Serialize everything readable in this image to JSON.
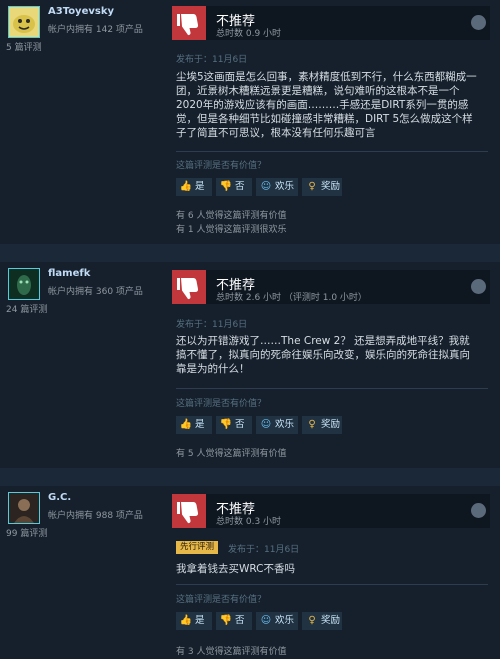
{
  "reviews": [
    {
      "username": "A3Toyevsky",
      "owned": "帐户内拥有 142 项产品",
      "review_count": "5 篇评测",
      "rec_title": "不推荐",
      "playtime": "总时数 0.9 小时",
      "posted": "发布于：11月6日",
      "content": "尘埃5这画面是怎么回事，素材精度低到不行，什么东西都糊成一团，近景树木糟糕远景更是糟糕，说句难听的这根本不是一个2020年的游戏应该有的画面………手感还是DIRT系列一贯的感觉，但是各种细节比如碰撞感非常糟糕，DIRT 5怎么做成这个样子了简直不可思议，根本没有任何乐趣可言",
      "helpful_q": "这篇评测是否有价值？",
      "btn_yes": "是",
      "btn_no": "否",
      "btn_funny": "欢乐",
      "btn_award": "奖励",
      "stats": [
        "有 6 人觉得这篇评测有价值",
        "有 1 人觉得这篇评测很欢乐"
      ]
    },
    {
      "username": "flamefk",
      "owned": "帐户内拥有 360 项产品",
      "review_count": "24 篇评测",
      "rec_title": "不推荐",
      "playtime": "总时数 2.6 小时 （评测时 1.0 小时）",
      "posted": "发布于：11月6日",
      "content": "还以为开错游戏了……The Crew 2？ 还是想弄成地平线？我就搞不懂了，拟真向的死命往娱乐向改变，娱乐向的死命往拟真向靠是为的什么！",
      "helpful_q": "这篇评测是否有价值？",
      "btn_yes": "是",
      "btn_no": "否",
      "btn_funny": "欢乐",
      "btn_award": "奖励",
      "stats": [
        "有 5 人觉得这篇评测有价值"
      ]
    },
    {
      "username": "G.C.",
      "owned": "帐户内拥有 988 项产品",
      "review_count": "99 篇评测",
      "rec_title": "不推荐",
      "playtime": "总时数 0.3 小时",
      "early_access": "先行评测",
      "posted": "发布于：11月6日",
      "content": "我拿着钱去买WRC不香吗",
      "helpful_q": "这篇评测是否有价值？",
      "btn_yes": "是",
      "btn_no": "否",
      "btn_funny": "欢乐",
      "btn_award": "奖励",
      "stats": [
        "有 3 人觉得这篇评测有价值"
      ]
    }
  ],
  "icons": {
    "thumbs_down": "thumbs-down-icon",
    "thumbs_up": "thumbs-up-icon",
    "smile": "smile-icon",
    "award": "award-icon",
    "steam": "steam-logo-icon"
  },
  "colors": {
    "not_recommended": "#c2373b",
    "link_blue": "#67c1f5",
    "early_access": "#e6b84a"
  }
}
